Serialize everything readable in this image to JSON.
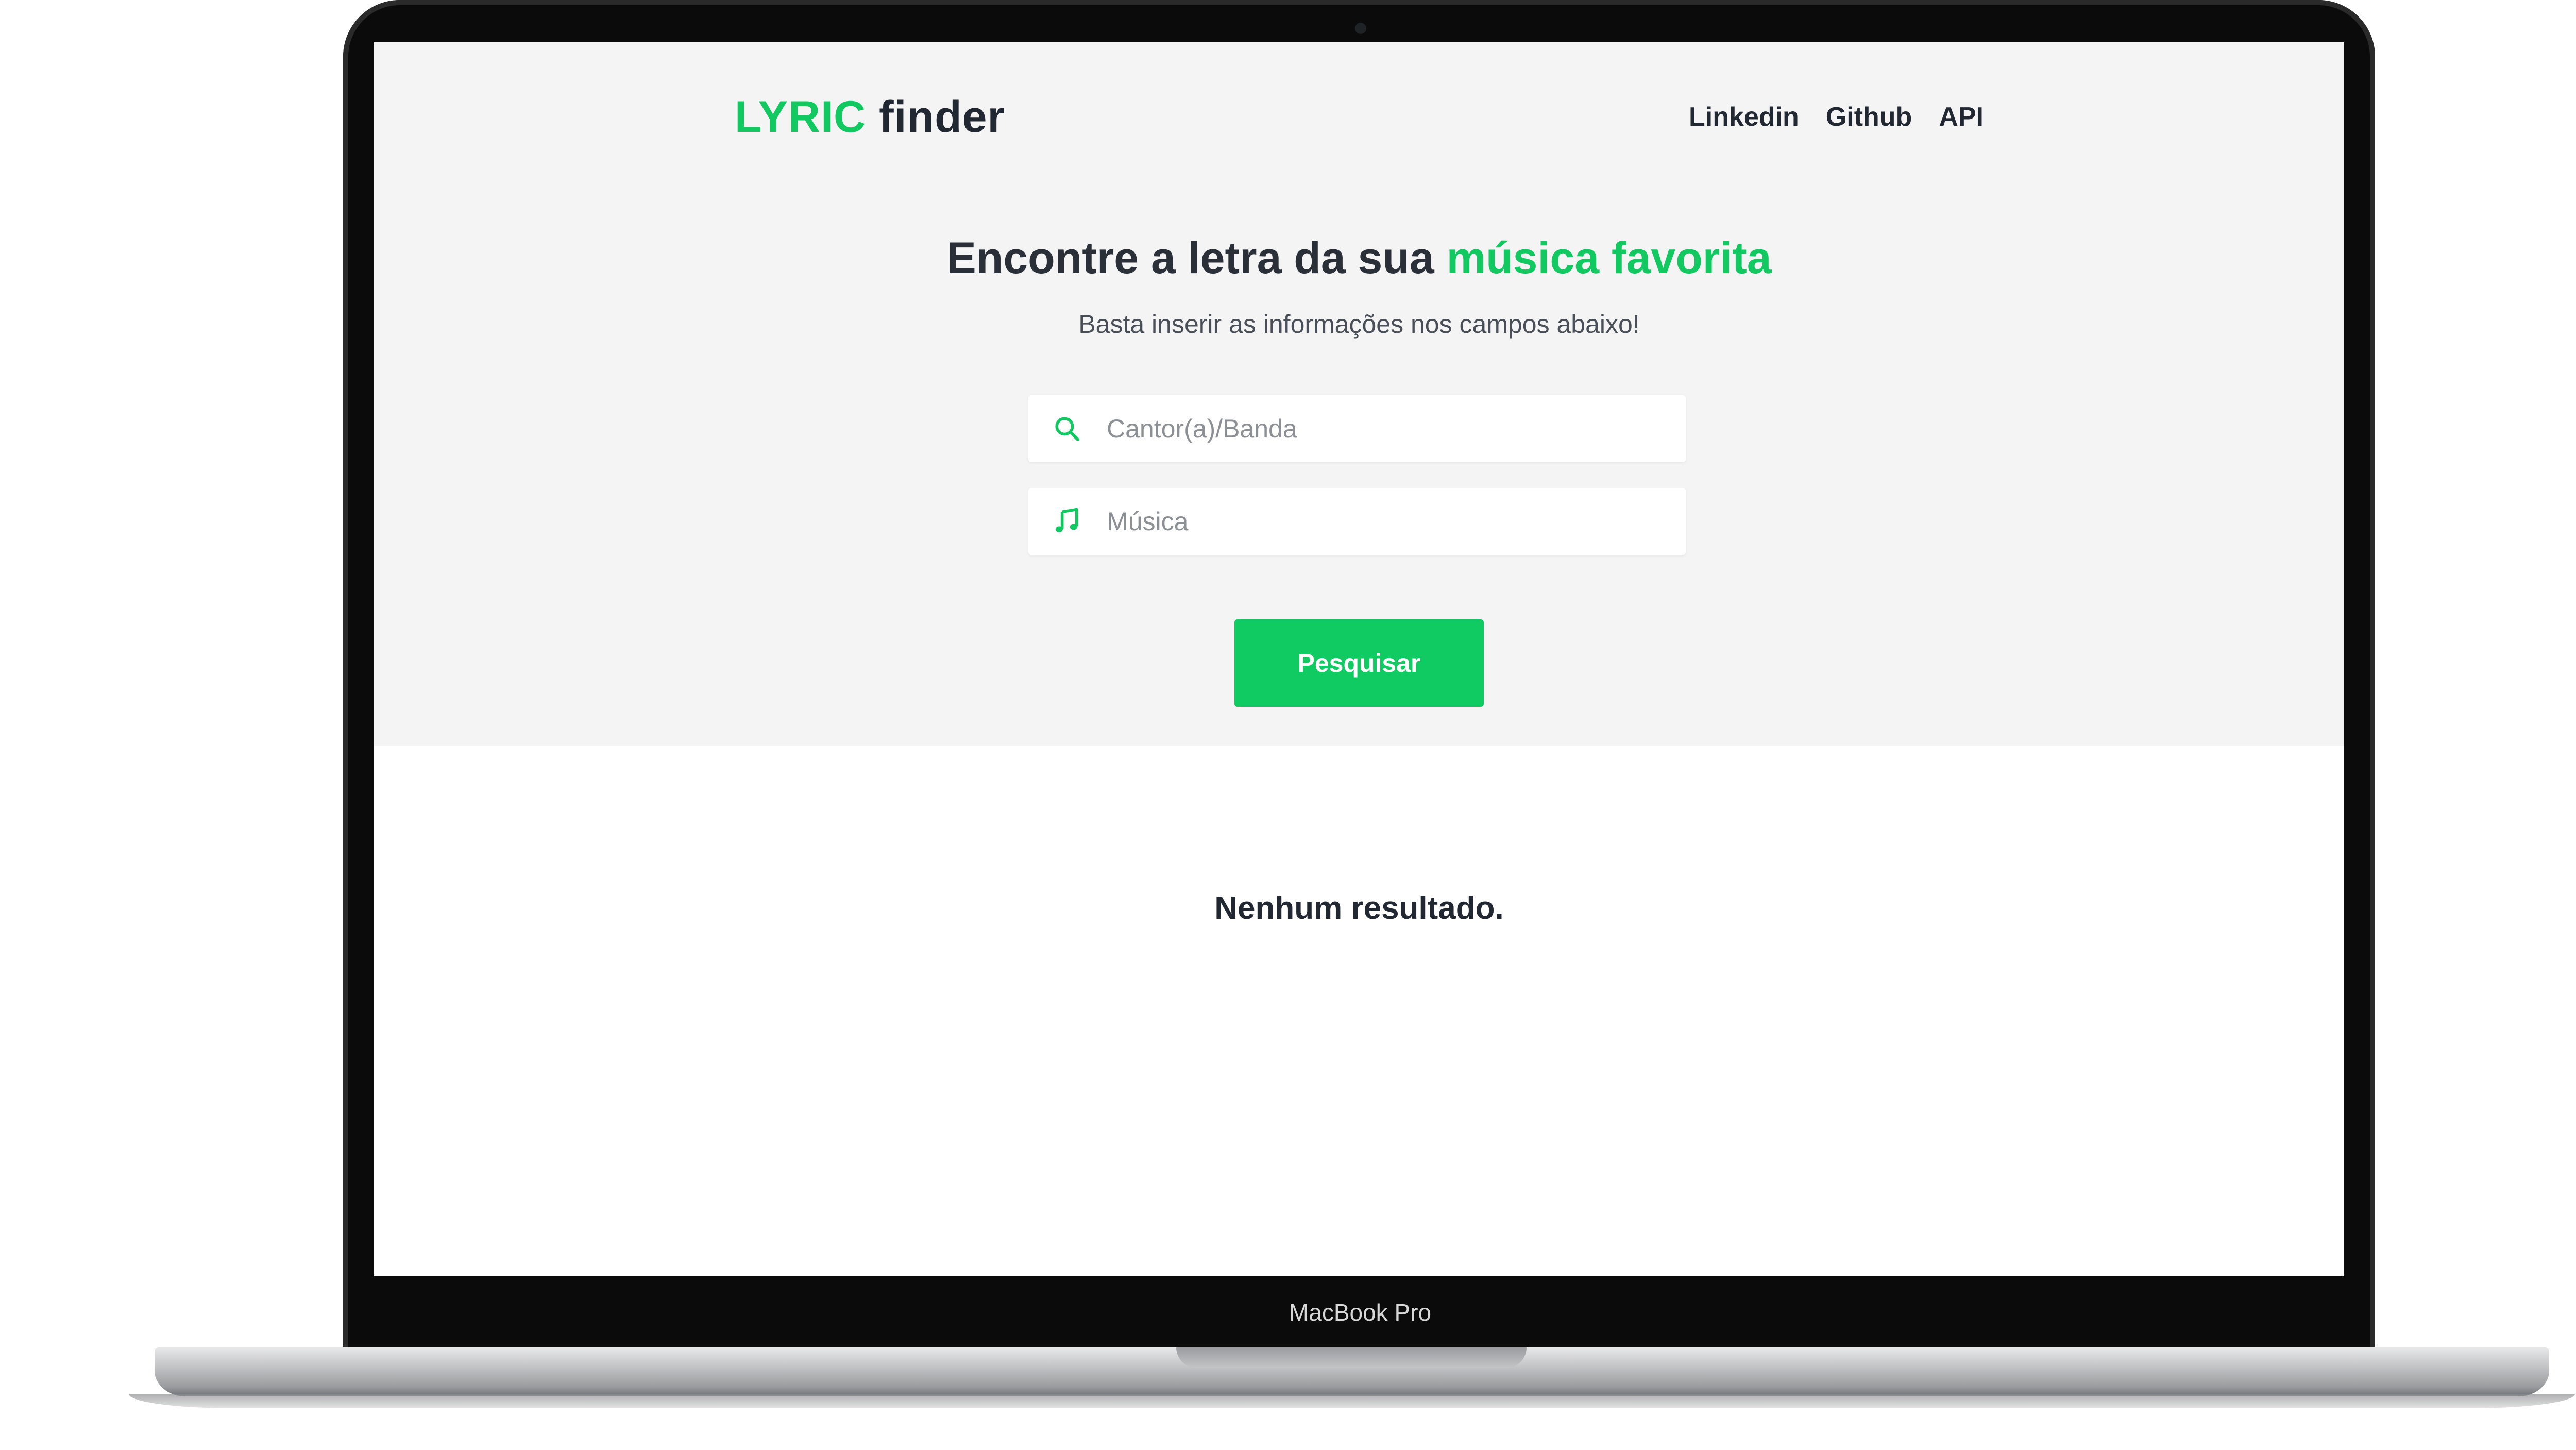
{
  "device": {
    "label": "MacBook Pro"
  },
  "brand": {
    "accent": "LYRIC",
    "rest": " finder",
    "accent_color": "#12c860",
    "text_color": "#222831"
  },
  "nav": {
    "items": [
      {
        "label": "Linkedin"
      },
      {
        "label": "Github"
      },
      {
        "label": "API"
      }
    ]
  },
  "hero": {
    "title_prefix": "Encontre a letra da sua ",
    "title_highlight": "música favorita",
    "subtitle": "Basta inserir as informações nos campos abaixo!"
  },
  "form": {
    "artist": {
      "placeholder": "Cantor(a)/Banda",
      "value": "",
      "icon": "search-icon"
    },
    "song": {
      "placeholder": "Música",
      "value": "",
      "icon": "music-note-icon"
    },
    "submit_label": "Pesquisar",
    "button_color": "#0fcb62"
  },
  "results": {
    "message": "Nenhum resultado."
  }
}
